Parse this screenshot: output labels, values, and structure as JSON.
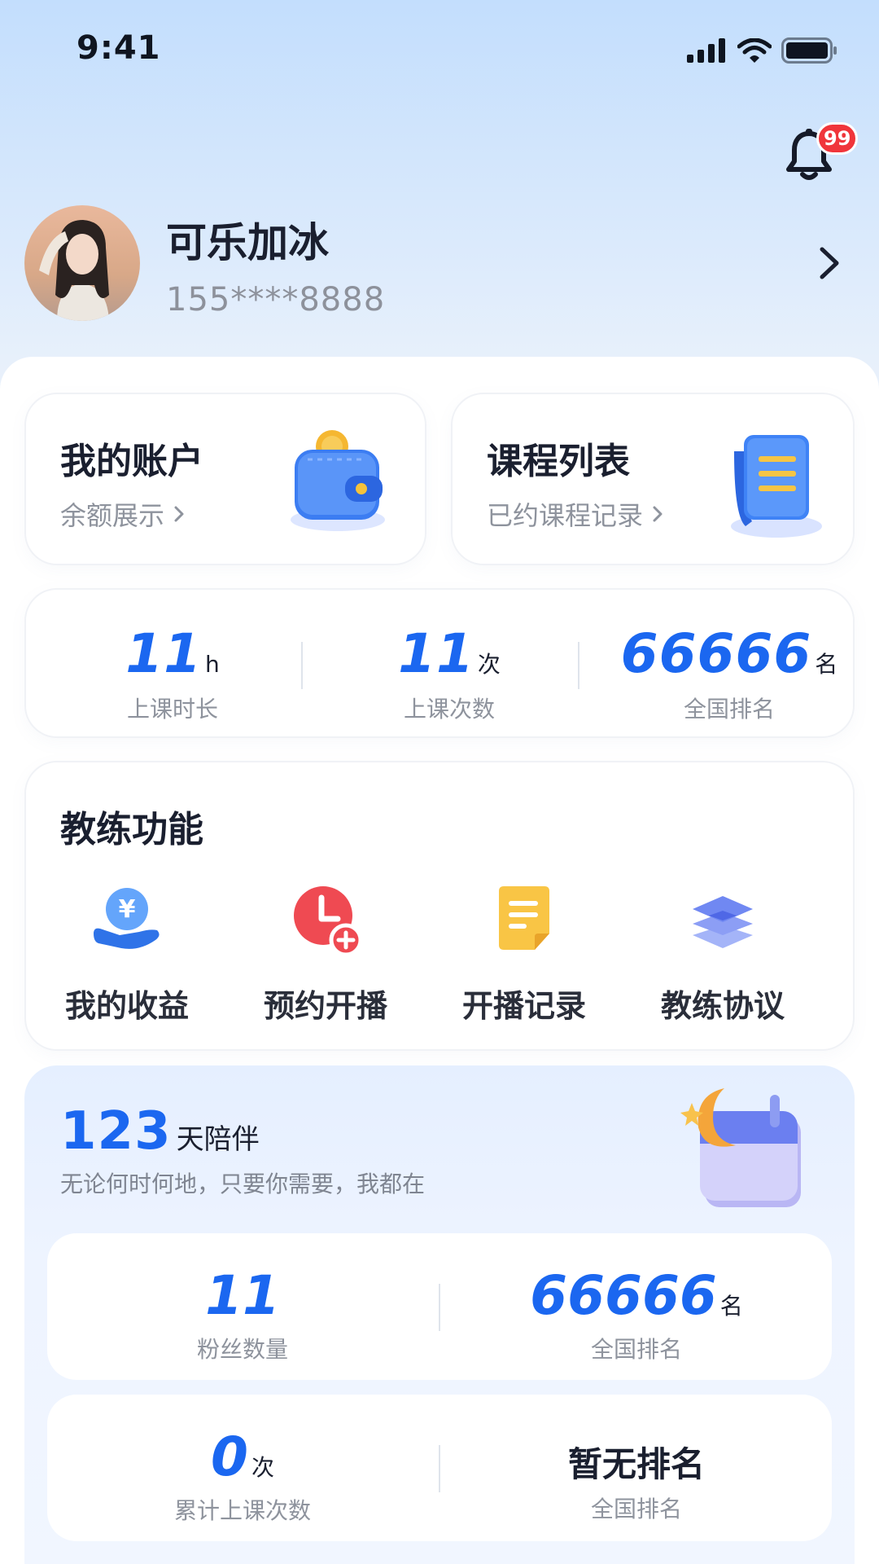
{
  "status_bar": {
    "time": "9:41"
  },
  "notifications": {
    "badge": "99"
  },
  "profile": {
    "name": "可乐加冰",
    "phone": "155****8888"
  },
  "cards": {
    "account": {
      "title": "我的账户",
      "subtitle": "余额展示"
    },
    "course": {
      "title": "课程列表",
      "subtitle": "已约课程记录"
    }
  },
  "stats": [
    {
      "value": "11",
      "unit": "h",
      "label": "上课时长"
    },
    {
      "value": "11",
      "unit": "次",
      "label": "上课次数"
    },
    {
      "value": "66666",
      "unit": "名",
      "label": "全国排名"
    }
  ],
  "coach": {
    "title": "教练功能",
    "items": [
      {
        "label": "我的收益",
        "icon": "yuan-hand-icon"
      },
      {
        "label": "预约开播",
        "icon": "clock-plus-icon"
      },
      {
        "label": "开播记录",
        "icon": "note-icon"
      },
      {
        "label": "教练协议",
        "icon": "layers-icon"
      }
    ]
  },
  "companion": {
    "days": "123",
    "days_suffix": "天陪伴",
    "description": "无论何时何地，只要你需要，我都在",
    "fans": {
      "value": "11",
      "label": "粉丝数量"
    },
    "fans_rank": {
      "value": "66666",
      "unit": "名",
      "label": "全国排名"
    },
    "lessons": {
      "value": "0",
      "unit": "次",
      "label": "累计上课次数"
    },
    "lessons_rank": {
      "value": "暂无排名",
      "label": "全国排名"
    }
  },
  "colors": {
    "accent": "#1b67f0",
    "badge": "#f0353b"
  }
}
